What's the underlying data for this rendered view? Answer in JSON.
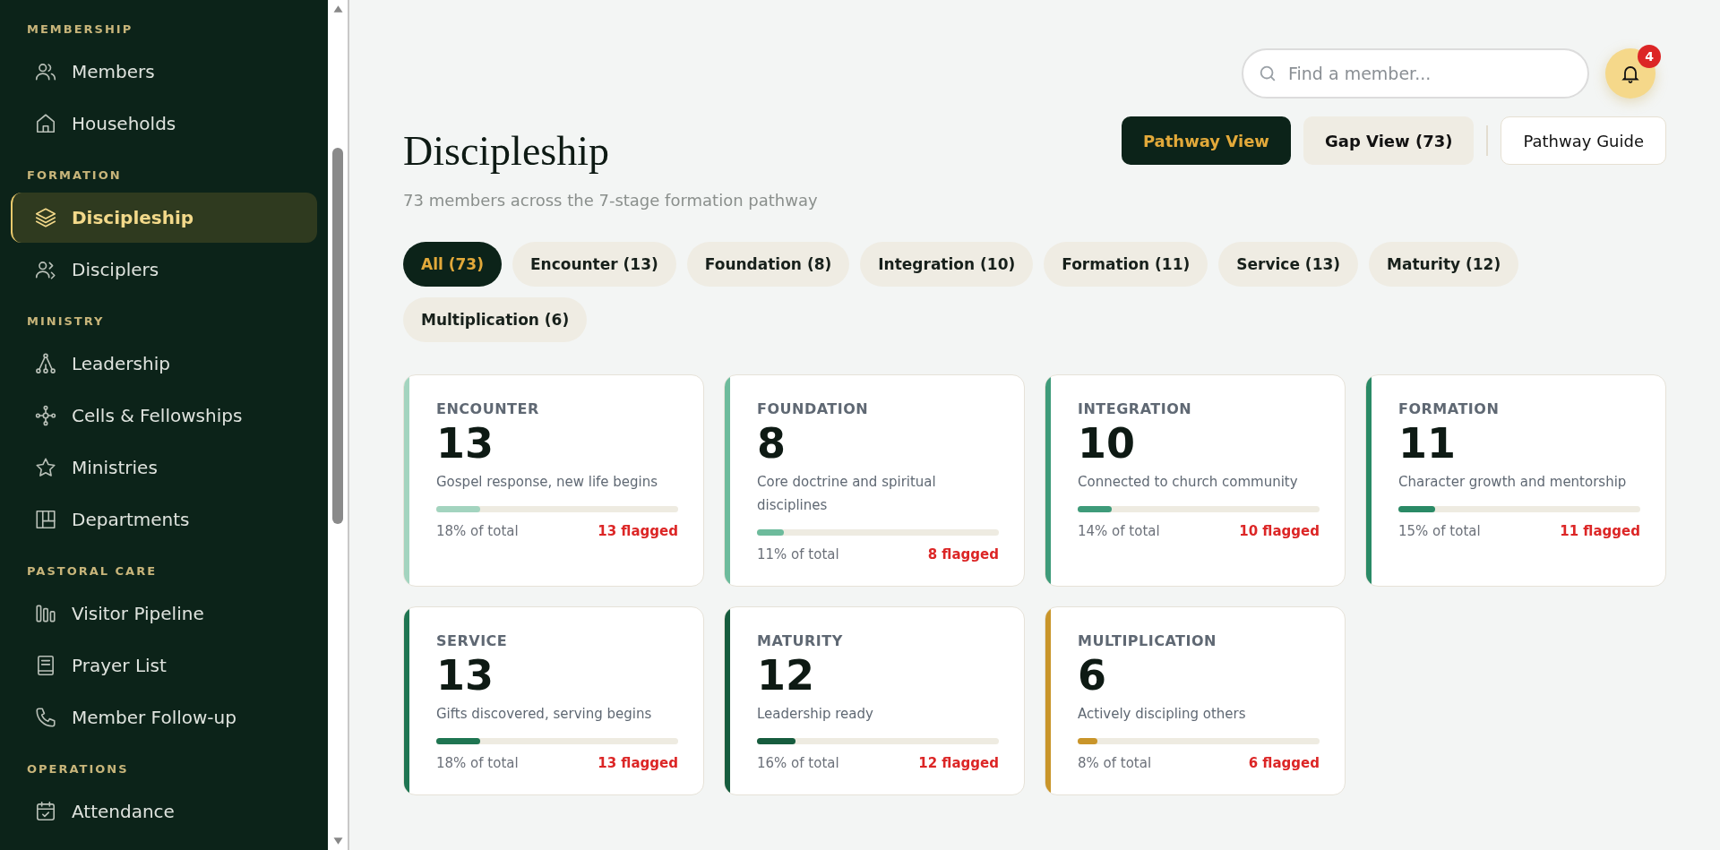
{
  "sidebar": {
    "sections": [
      {
        "label": "MEMBERSHIP",
        "items": [
          {
            "label": "Members",
            "selected": false
          },
          {
            "label": "Households",
            "selected": false
          }
        ]
      },
      {
        "label": "FORMATION",
        "items": [
          {
            "label": "Discipleship",
            "selected": true
          },
          {
            "label": "Disciplers",
            "selected": false
          }
        ]
      },
      {
        "label": "MINISTRY",
        "items": [
          {
            "label": "Leadership",
            "selected": false
          },
          {
            "label": "Cells & Fellowships",
            "selected": false
          },
          {
            "label": "Ministries",
            "selected": false
          },
          {
            "label": "Departments",
            "selected": false
          }
        ]
      },
      {
        "label": "PASTORAL CARE",
        "items": [
          {
            "label": "Visitor Pipeline",
            "selected": false
          },
          {
            "label": "Prayer List",
            "selected": false
          },
          {
            "label": "Member Follow-up",
            "selected": false
          }
        ]
      },
      {
        "label": "OPERATIONS",
        "items": [
          {
            "label": "Attendance",
            "selected": false
          }
        ]
      }
    ]
  },
  "search": {
    "placeholder": "Find a member..."
  },
  "notifications": {
    "count": "4"
  },
  "page": {
    "title": "Discipleship",
    "subtitle": "73 members across the 7-stage formation pathway"
  },
  "views": [
    {
      "label": "Pathway View",
      "selected": true
    },
    {
      "label": "Gap View (73)",
      "selected": false
    }
  ],
  "guide_button": "Pathway Guide",
  "filters": [
    {
      "label": "All (73)",
      "selected": true
    },
    {
      "label": "Encounter (13)",
      "selected": false
    },
    {
      "label": "Foundation (8)",
      "selected": false
    },
    {
      "label": "Integration (10)",
      "selected": false
    },
    {
      "label": "Formation (11)",
      "selected": false
    },
    {
      "label": "Service (13)",
      "selected": false
    },
    {
      "label": "Maturity (12)",
      "selected": false
    },
    {
      "label": "Multiplication (6)",
      "selected": false
    }
  ],
  "stages": [
    {
      "name": "ENCOUNTER",
      "count": "13",
      "description": "Gospel response, new life begins",
      "level": 0.18,
      "share": "18% of total",
      "flagged": "13 flagged",
      "color": "#a3d4bf"
    },
    {
      "name": "FOUNDATION",
      "count": "8",
      "description": "Core doctrine and spiritual disciplines",
      "level": 0.11,
      "share": "11% of total",
      "flagged": "8 flagged",
      "color": "#6dbb9c"
    },
    {
      "name": "INTEGRATION",
      "count": "10",
      "description": "Connected to church community",
      "level": 0.14,
      "share": "14% of total",
      "flagged": "10 flagged",
      "color": "#3e9b7a"
    },
    {
      "name": "FORMATION",
      "count": "11",
      "description": "Character growth and mentorship",
      "level": 0.15,
      "share": "15% of total",
      "flagged": "11 flagged",
      "color": "#2a8a66"
    },
    {
      "name": "SERVICE",
      "count": "13",
      "description": "Gifts discovered, serving begins",
      "level": 0.18,
      "share": "18% of total",
      "flagged": "13 flagged",
      "color": "#1f7552"
    },
    {
      "name": "MATURITY",
      "count": "12",
      "description": "Leadership ready",
      "level": 0.16,
      "share": "16% of total",
      "flagged": "12 flagged",
      "color": "#165c3e"
    },
    {
      "name": "MULTIPLICATION",
      "count": "6",
      "description": "Actively discipling others",
      "level": 0.08,
      "share": "8% of total",
      "flagged": "6 flagged",
      "color": "#c9952a"
    }
  ]
}
